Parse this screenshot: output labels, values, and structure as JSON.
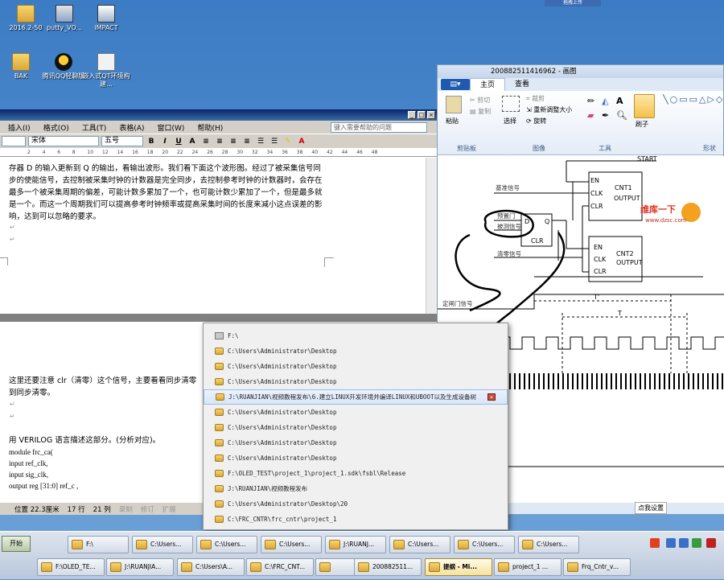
{
  "desktop": {
    "icons": [
      {
        "label": "2016.2-50",
        "kind": "folder"
      },
      {
        "label": "putty_VO...",
        "kind": "putty"
      },
      {
        "label": "iMPACT",
        "kind": "impact"
      },
      {
        "label": "BAK",
        "kind": "folder"
      },
      {
        "label": "腾讯QQ轻聊版",
        "kind": "qq"
      },
      {
        "label": "嵌入式QT环境构建...",
        "kind": "doc"
      }
    ],
    "upload_button": "拖拽上传",
    "tray_popup": "点我设置"
  },
  "word": {
    "menu": [
      "插入(I)",
      "格式(O)",
      "工具(T)",
      "表格(A)",
      "窗口(W)",
      "帮助(H)"
    ],
    "help_placeholder": "键入需要帮助的问题",
    "font_name": "宋体",
    "font_size": "五号",
    "ruler_ticks": [
      "2",
      "4",
      "6",
      "8",
      "10",
      "12",
      "14",
      "16",
      "18",
      "20",
      "22",
      "24",
      "26",
      "28",
      "30",
      "32",
      "34",
      "36",
      "38",
      "40",
      "42",
      "44",
      "46",
      "48"
    ],
    "paragraph1": "存器 D 的输入更新到 Q 的输出，看输出波形。我们看下面这个波形图。经过了被采集信号同步的使能信号，去控制被采集时钟的计数器是完全同步，去控制参考时钟的计数器时，会存在最多一个被采集周期的偏差，可能计数多累加了一个，也可能计数少累加了一个，但是最多就是一个。而这一个周期我们可以提高参考时钟频率或提高采集时间的长度来减小这点误差的影响，达到可以忽略的要求。",
    "paragraph2": "这里还要注意 clr（清零）这个信号，主要看看同步清零",
    "paragraph2b": "到同步清零。",
    "paragraph3": "用 VERILOG 语言描述这部分。(分析对应)。",
    "code_lines": [
      "module frc_ca(",
      "input ref_clk,",
      "input sig_clk,",
      "output reg [31:0] ref_c ,"
    ],
    "status": {
      "position": "位置 22.3厘米",
      "line": "17 行",
      "col": "21 列",
      "rec": "录制",
      "trk": "修订",
      "ext": "扩展"
    }
  },
  "paint": {
    "title": "200882511416962 - 画图",
    "tabs": [
      "主页",
      "查看"
    ],
    "clipboard": {
      "paste": "粘贴",
      "cut": "剪切",
      "copy": "复制",
      "group": "剪贴板"
    },
    "image": {
      "select": "选择",
      "crop": "裁剪",
      "resize": "重新调整大小",
      "rotate": "旋转",
      "group": "图像"
    },
    "tools_group": "工具",
    "brush": "刷子",
    "shapes_group": "形状",
    "diagram": {
      "start": "START",
      "cnt1": [
        "EN",
        "CLK",
        "CLR",
        "CNT1",
        "OUTPUT"
      ],
      "cnt2": [
        "EN",
        "CLK",
        "CLR",
        "CNT2",
        "OUTPUT"
      ],
      "dff": [
        "D",
        "Q",
        "CLR"
      ],
      "labels": {
        "base": "基准信号",
        "preset": "预置门",
        "measured": "被测信号",
        "clear": "清零信号",
        "gate": "定闸门信号",
        "t_prime": "T'",
        "t": "T"
      },
      "watermark": "维库一下",
      "watermark_url": "www.dzsc.com"
    }
  },
  "jumplist": {
    "items": [
      "F:\\",
      "C:\\Users\\Administrator\\Desktop",
      "C:\\Users\\Administrator\\Desktop",
      "C:\\Users\\Administrator\\Desktop",
      "J:\\RUANJIAN\\视频教程发布\\6.建立LINUX开发环境并编译LINUX和UBOOT以及生成设备树",
      "C:\\Users\\Administrator\\Desktop",
      "C:\\Users\\Administrator\\Desktop",
      "C:\\Users\\Administrator\\Desktop",
      "C:\\Users\\Administrator\\Desktop",
      "F:\\OLED_TEST\\project_1\\project_1.sdk\\fsbl\\Release",
      "J:\\RUANJIAN\\视频教程发布",
      "C:\\Users\\Administrator\\Desktop\\20",
      "C:\\FRC_CNTR\\frc_cntr\\project_1"
    ],
    "hover_index": 4
  },
  "taskbar": {
    "start": "开始",
    "row1": [
      "F:\\",
      "C:\\Users...",
      "C:\\Users...",
      "C:\\Users...",
      "J:\\RUANJ...",
      "C:\\Users...",
      "C:\\Users...",
      "C:\\Users..."
    ],
    "row2": [
      "F:\\OLED_TE...",
      "J:\\RUANJIA...",
      "C:\\Users\\A...",
      "C:\\FRC_CNT...",
      "",
      "200882511...",
      "提纲 - Mi...",
      "project_1 ...",
      "Frq_Cntr_v..."
    ]
  },
  "colors": {
    "accent": "#1e5ab0",
    "hover": "#d8e6f8",
    "word_title": "#0a246a"
  }
}
